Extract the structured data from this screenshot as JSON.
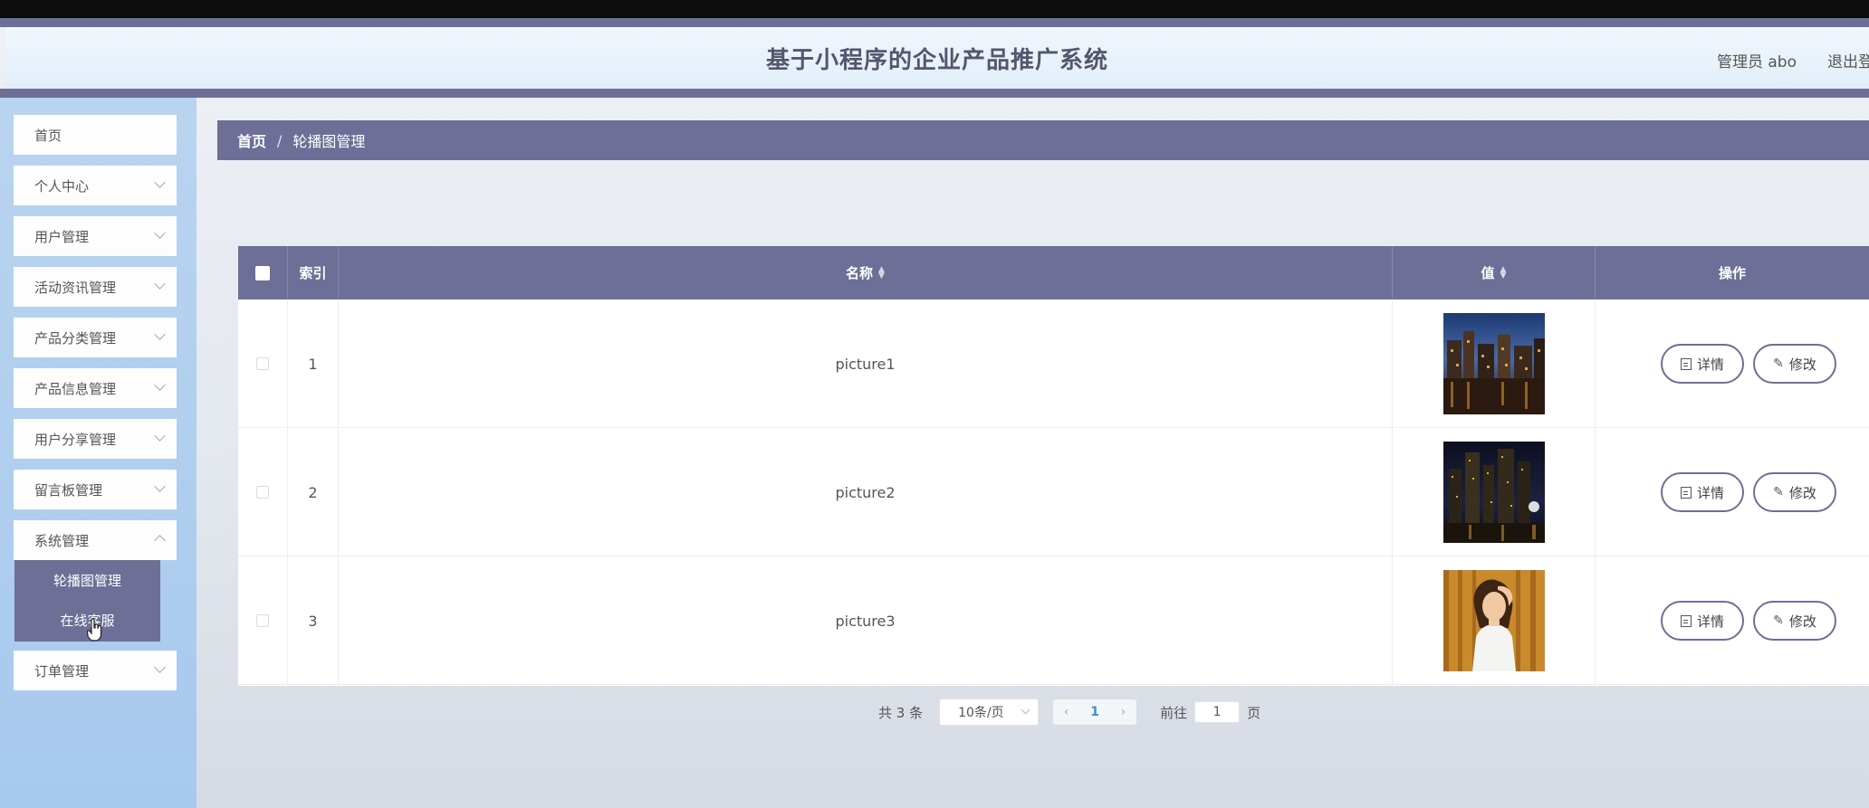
{
  "header": {
    "title": "基于小程序的企业产品推广系统",
    "user": "管理员 abo",
    "logout": "退出登录"
  },
  "sidebar": {
    "items": [
      {
        "label": "首页"
      },
      {
        "label": "个人中心"
      },
      {
        "label": "用户管理"
      },
      {
        "label": "活动资讯管理"
      },
      {
        "label": "产品分类管理"
      },
      {
        "label": "产品信息管理"
      },
      {
        "label": "用户分享管理"
      },
      {
        "label": "留言板管理"
      },
      {
        "label": "系统管理"
      },
      {
        "label": "订单管理"
      }
    ],
    "submenu": [
      {
        "label": "轮播图管理"
      },
      {
        "label": "在线客服"
      }
    ]
  },
  "breadcrumb": {
    "home": "首页",
    "sep": "/",
    "current": "轮播图管理"
  },
  "table": {
    "columns": [
      "索引",
      "名称",
      "值",
      "操作"
    ],
    "rows": [
      {
        "index": "1",
        "name": "picture1"
      },
      {
        "index": "2",
        "name": "picture2"
      },
      {
        "index": "3",
        "name": "picture3"
      }
    ],
    "actions": {
      "detail": "详情",
      "edit": "修改"
    }
  },
  "pagination": {
    "total": "共 3 条",
    "page_size": "10条/页",
    "current_page": "1",
    "goto_label": "前往",
    "goto_value": "1",
    "page_suffix": "页"
  },
  "colors": {
    "accent": "#6d6f96",
    "sidebar": "#b9d4ef",
    "header": "#e8f3fb"
  }
}
